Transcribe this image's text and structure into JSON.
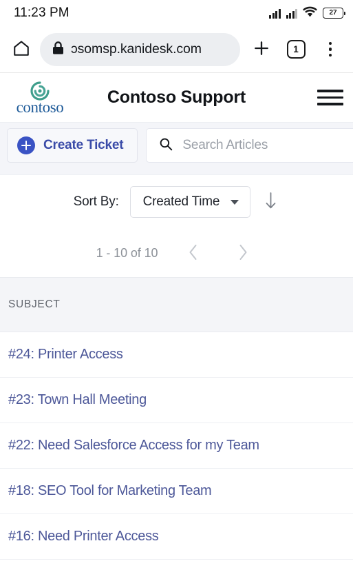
{
  "status_bar": {
    "time": "11:23 PM",
    "battery_level": "27",
    "icons": [
      "signal-bars-icon",
      "signal-bars-icon",
      "wifi-icon",
      "battery-icon"
    ]
  },
  "browser": {
    "home_icon": "home-icon",
    "lock_icon": "lock-icon",
    "url": "ɔsomsp.kanidesk.com",
    "new_tab_icon": "plus-icon",
    "tab_count": "1",
    "menu_icon": "three-dot-menu-icon"
  },
  "site_header": {
    "brand_name": "contoso",
    "brand_mark": "spiral-logo-icon",
    "title": "Contoso Support",
    "menu_icon": "hamburger-menu-icon"
  },
  "toolbar": {
    "create_label": "Create Ticket",
    "create_icon": "plus-circle-icon",
    "search_icon": "search-icon",
    "search_placeholder": "Search Articles",
    "search_value": ""
  },
  "sort": {
    "label": "Sort By:",
    "selected": "Created Time",
    "options": [
      "Created Time"
    ],
    "caret_icon": "chevron-down-icon",
    "direction_icon": "arrow-down-icon"
  },
  "pagination": {
    "range": "1 - 10 of 10",
    "prev_icon": "chevron-left-icon",
    "next_icon": "chevron-right-icon"
  },
  "table": {
    "columns": [
      "SUBJECT"
    ],
    "rows": [
      {
        "subject": "#24: Printer Access"
      },
      {
        "subject": "#23: Town Hall Meeting"
      },
      {
        "subject": "#22: Need Salesforce Access for my Team"
      },
      {
        "subject": "#18: SEO Tool for Marketing Team"
      },
      {
        "subject": "#16: Need Printer Access"
      }
    ]
  },
  "colors": {
    "brand_blue": "#1f5b99",
    "brand_green": "#3f9e8c",
    "accent": "#3a53c4",
    "link": "#4d5899",
    "toolbar_bg": "#f4f5f9"
  }
}
